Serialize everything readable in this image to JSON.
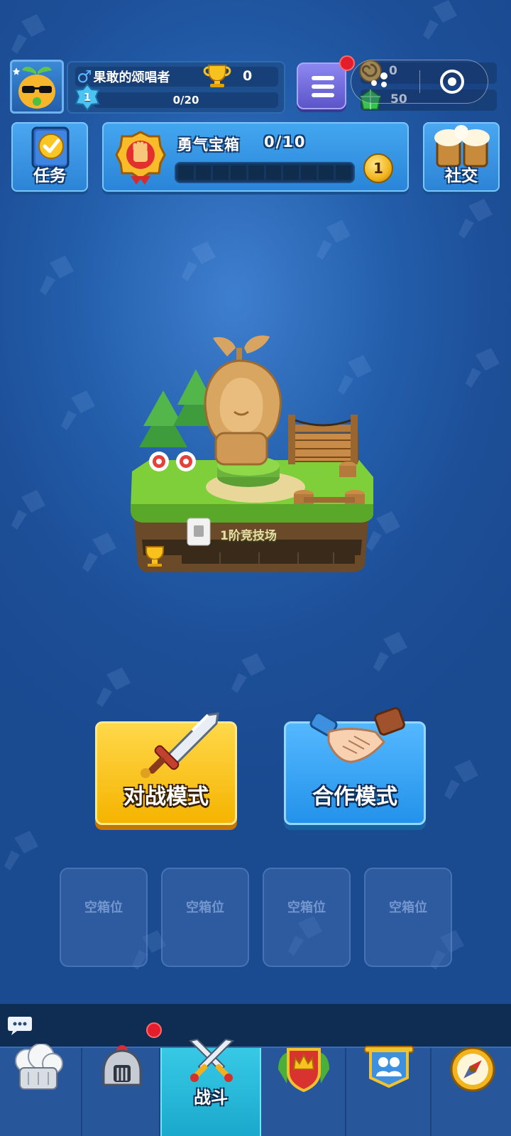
{
  "profile": {
    "name": "果敢的颂唱者",
    "gender_symbol": "♂",
    "trophies": "0",
    "level": "1",
    "xp": "0/20"
  },
  "currency": {
    "gold": "0",
    "gems": "50"
  },
  "buttons": {
    "tasks": "任务",
    "social": "社交"
  },
  "chest": {
    "title": "勇气宝箱",
    "progress": "0/10",
    "coin_count": "1"
  },
  "arena": {
    "name": "1阶竞技场"
  },
  "modes": {
    "battle": "对战模式",
    "coop": "合作模式"
  },
  "slots": [
    "空箱位",
    "空箱位",
    "空箱位",
    "空箱位"
  ],
  "nav": {
    "active_label": "战斗"
  },
  "icons": {
    "avatar": "sprout-sunglasses-avatar-icon",
    "menu": "hamburger-menu-icon",
    "miniprogram_more": "more-dots-icon",
    "miniprogram_close": "target-close-icon",
    "tasks": "checklist-book-icon",
    "social": "beer-mugs-icon",
    "chest": "fist-badge-icon",
    "battle_mode": "sword-icon",
    "coop_mode": "handshake-icon",
    "chat": "speech-bubble-icon",
    "nav": [
      "chef-hat-icon",
      "knight-helmet-icon",
      "crossed-swords-icon",
      "crown-shield-icon",
      "clan-banner-icon",
      "compass-icon"
    ]
  },
  "colors": {
    "background": "#2460ad",
    "battle_button": "#f5b400",
    "coop_button": "#2392ea",
    "active_tab": "#1aa8cc",
    "notification": "#e41d2c"
  }
}
